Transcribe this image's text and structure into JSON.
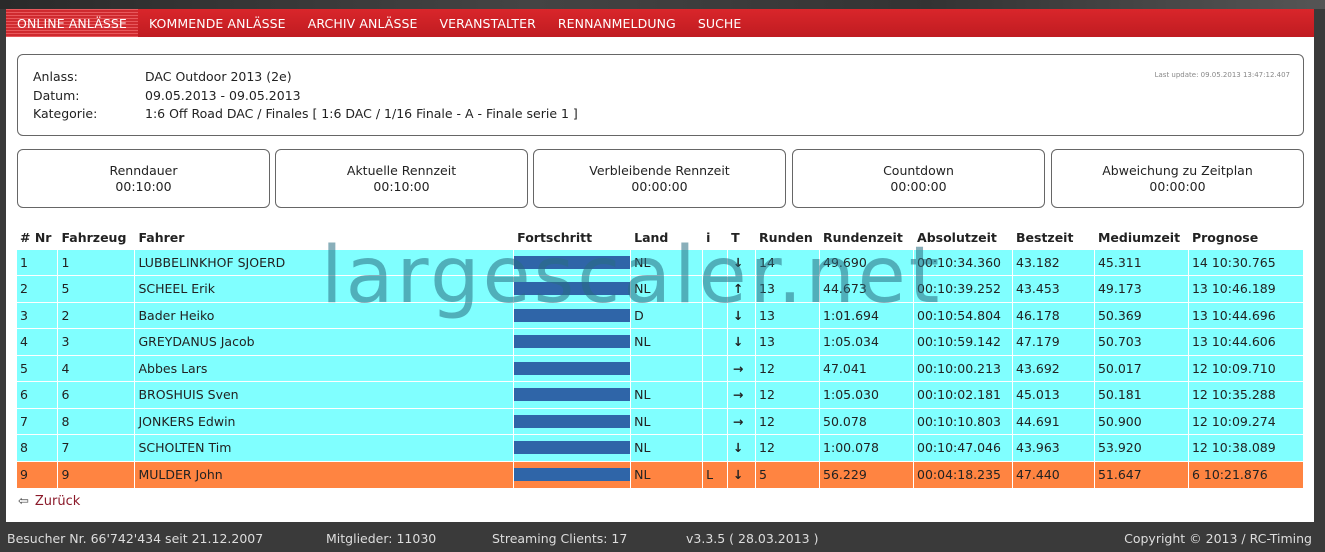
{
  "nav": [
    {
      "label": "ONLINE ANLÄSSE",
      "active": true
    },
    {
      "label": "KOMMENDE ANLÄSSE"
    },
    {
      "label": "ARCHIV ANLÄSSE"
    },
    {
      "label": "VERANSTALTER"
    },
    {
      "label": "RENNANMELDUNG"
    },
    {
      "label": "SUCHE"
    }
  ],
  "info": {
    "anlass_label": "Anlass:",
    "anlass_value": "DAC Outdoor 2013 (2e)",
    "datum_label": "Datum:",
    "datum_value": "09.05.2013 - 09.05.2013",
    "kategorie_label": "Kategorie:",
    "kategorie_value": "1:6 Off Road DAC / Finales [ 1:6 DAC / 1/16 Finale - A - Finale serie 1 ]",
    "last_update": "Last update: 09.05.2013 13:47:12.407"
  },
  "stats": [
    {
      "title": "Renndauer",
      "value": "00:10:00"
    },
    {
      "title": "Aktuelle Rennzeit",
      "value": "00:10:00"
    },
    {
      "title": "Verbleibende Rennzeit",
      "value": "00:00:00"
    },
    {
      "title": "Countdown",
      "value": "00:00:00"
    },
    {
      "title": "Abweichung zu Zeitplan",
      "value": "00:00:00"
    }
  ],
  "table": {
    "headers": [
      "# Nr",
      "Fahrzeug",
      "Fahrer",
      "Fortschritt",
      "Land",
      "i",
      "T",
      "Runden",
      "Rundenzeit",
      "Absolutzeit",
      "Bestzeit",
      "Mediumzeit",
      "Prognose"
    ],
    "rows": [
      {
        "pos": "1",
        "car": "1",
        "driver": "LUBBELINKHOF SJOERD",
        "progress": 1.0,
        "land": "NL",
        "info": "",
        "trend": "down",
        "laps": "14",
        "laptime": "49.690",
        "abs": "00:10:34.360",
        "best": "43.182",
        "medium": "45.311",
        "prog": "14 10:30.765"
      },
      {
        "pos": "2",
        "car": "5",
        "driver": "SCHEEL Erik",
        "progress": 1.0,
        "land": "NL",
        "info": "",
        "trend": "up",
        "laps": "13",
        "laptime": "44.673",
        "abs": "00:10:39.252",
        "best": "43.453",
        "medium": "49.173",
        "prog": "13 10:46.189"
      },
      {
        "pos": "3",
        "car": "2",
        "driver": "Bader Heiko",
        "progress": 1.0,
        "land": "D",
        "info": "",
        "trend": "down",
        "laps": "13",
        "laptime": "1:01.694",
        "abs": "00:10:54.804",
        "best": "46.178",
        "medium": "50.369",
        "prog": "13 10:44.696"
      },
      {
        "pos": "4",
        "car": "3",
        "driver": "GREYDANUS Jacob",
        "progress": 1.0,
        "land": "NL",
        "info": "",
        "trend": "down",
        "laps": "13",
        "laptime": "1:05.034",
        "abs": "00:10:59.142",
        "best": "47.179",
        "medium": "50.703",
        "prog": "13 10:44.606"
      },
      {
        "pos": "5",
        "car": "4",
        "driver": "Abbes Lars",
        "progress": 1.0,
        "land": "",
        "info": "",
        "trend": "right",
        "laps": "12",
        "laptime": "47.041",
        "abs": "00:10:00.213",
        "best": "43.692",
        "medium": "50.017",
        "prog": "12 10:09.710"
      },
      {
        "pos": "6",
        "car": "6",
        "driver": "BROSHUIS Sven",
        "progress": 1.0,
        "land": "NL",
        "info": "",
        "trend": "right",
        "laps": "12",
        "laptime": "1:05.030",
        "abs": "00:10:02.181",
        "best": "45.013",
        "medium": "50.181",
        "prog": "12 10:35.288"
      },
      {
        "pos": "7",
        "car": "8",
        "driver": "JONKERS Edwin",
        "progress": 1.0,
        "land": "NL",
        "info": "",
        "trend": "right",
        "laps": "12",
        "laptime": "50.078",
        "abs": "00:10:10.803",
        "best": "44.691",
        "medium": "50.900",
        "prog": "12 10:09.274"
      },
      {
        "pos": "8",
        "car": "7",
        "driver": "SCHOLTEN Tim",
        "progress": 1.0,
        "land": "NL",
        "info": "",
        "trend": "down",
        "laps": "12",
        "laptime": "1:00.078",
        "abs": "00:10:47.046",
        "best": "43.963",
        "medium": "53.920",
        "prog": "12 10:38.089"
      },
      {
        "pos": "9",
        "car": "9",
        "driver": "MULDER John",
        "progress": 1.0,
        "land": "NL",
        "info": "L",
        "trend": "down",
        "laps": "5",
        "laptime": "56.229",
        "abs": "00:04:18.235",
        "best": "47.440",
        "medium": "51.647",
        "prog": "6 10:21.876",
        "highlight": true
      }
    ]
  },
  "back_label": "Zurück",
  "watermark": "largescaler.net",
  "footer": {
    "visitors": "Besucher Nr. 66'742'434 seit 21.12.2007",
    "members": "Mitglieder: 11030",
    "streaming": "Streaming Clients: 17",
    "version": "v3.3.5 ( 28.03.2013 )",
    "copyright": "Copyright © 2013 / RC-Timing"
  },
  "colors": {
    "nav_red": "#c8202a",
    "row_cyan": "#80ffff",
    "row_highlight": "#ff8441",
    "progress_bar": "#2f65a8"
  }
}
